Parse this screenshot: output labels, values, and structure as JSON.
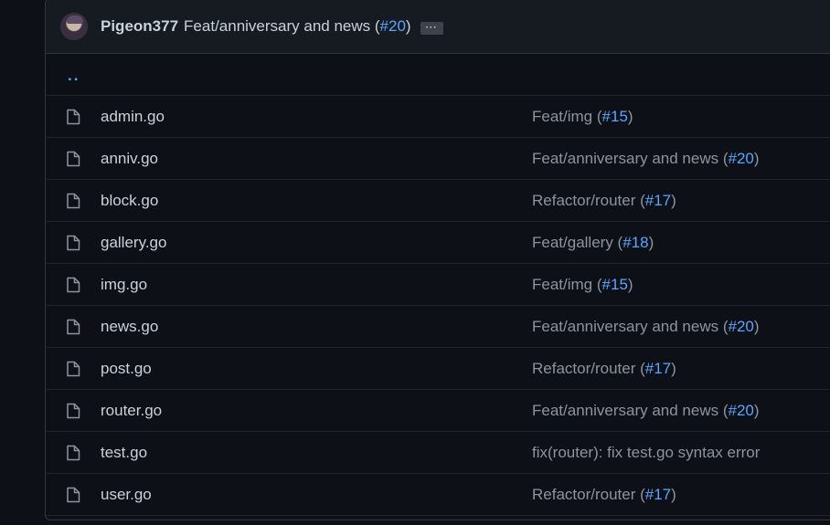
{
  "commit": {
    "author": "Pigeon377",
    "message": "Feat/anniversary and news (",
    "pr": "#20",
    "message_suffix": ")",
    "ellipsis": "···"
  },
  "parent_dir": "..",
  "files": [
    {
      "name": "admin.go",
      "msg": "Feat/img (",
      "pr": "#15",
      "suffix": ")"
    },
    {
      "name": "anniv.go",
      "msg": "Feat/anniversary and news (",
      "pr": "#20",
      "suffix": ")"
    },
    {
      "name": "block.go",
      "msg": "Refactor/router (",
      "pr": "#17",
      "suffix": ")"
    },
    {
      "name": "gallery.go",
      "msg": "Feat/gallery (",
      "pr": "#18",
      "suffix": ")"
    },
    {
      "name": "img.go",
      "msg": "Feat/img (",
      "pr": "#15",
      "suffix": ")"
    },
    {
      "name": "news.go",
      "msg": "Feat/anniversary and news (",
      "pr": "#20",
      "suffix": ")"
    },
    {
      "name": "post.go",
      "msg": "Refactor/router (",
      "pr": "#17",
      "suffix": ")"
    },
    {
      "name": "router.go",
      "msg": "Feat/anniversary and news (",
      "pr": "#20",
      "suffix": ")"
    },
    {
      "name": "test.go",
      "msg": "fix(router): fix test.go syntax error",
      "pr": "",
      "suffix": ""
    },
    {
      "name": "user.go",
      "msg": "Refactor/router (",
      "pr": "#17",
      "suffix": ")"
    }
  ],
  "icons": {
    "file": "file-icon",
    "avatar": "user-avatar"
  },
  "colors": {
    "link": "#58a6ff",
    "background": "#0d1117",
    "header": "#161b22"
  }
}
